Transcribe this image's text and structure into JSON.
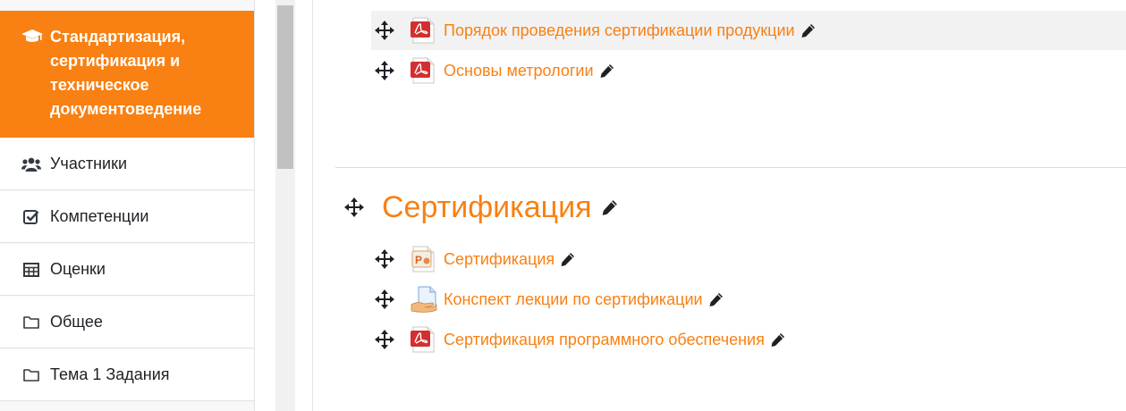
{
  "sidebar": {
    "course_title": "Стандартизация, сертификация и техническое документоведение",
    "items": [
      {
        "label": "Участники",
        "icon": "users-icon"
      },
      {
        "label": "Компетенции",
        "icon": "checkbox-icon"
      },
      {
        "label": "Оценки",
        "icon": "table-icon"
      },
      {
        "label": "Общее",
        "icon": "folder-icon"
      },
      {
        "label": "Тема 1 Задания",
        "icon": "folder-icon"
      }
    ]
  },
  "main": {
    "top_items": [
      {
        "label": "Порядок проведения сертификации продукции",
        "type": "pdf"
      },
      {
        "label": "Основы метрологии",
        "type": "pdf"
      }
    ],
    "section": {
      "title": "Сертификация",
      "items": [
        {
          "label": "Сертификация",
          "type": "ppt"
        },
        {
          "label": "Конспект лекции по сертификации",
          "type": "assignment"
        },
        {
          "label": "Сертификация программного обеспечения",
          "type": "pdf"
        }
      ]
    }
  },
  "colors": {
    "accent": "#f98012",
    "text": "#1d2125"
  }
}
